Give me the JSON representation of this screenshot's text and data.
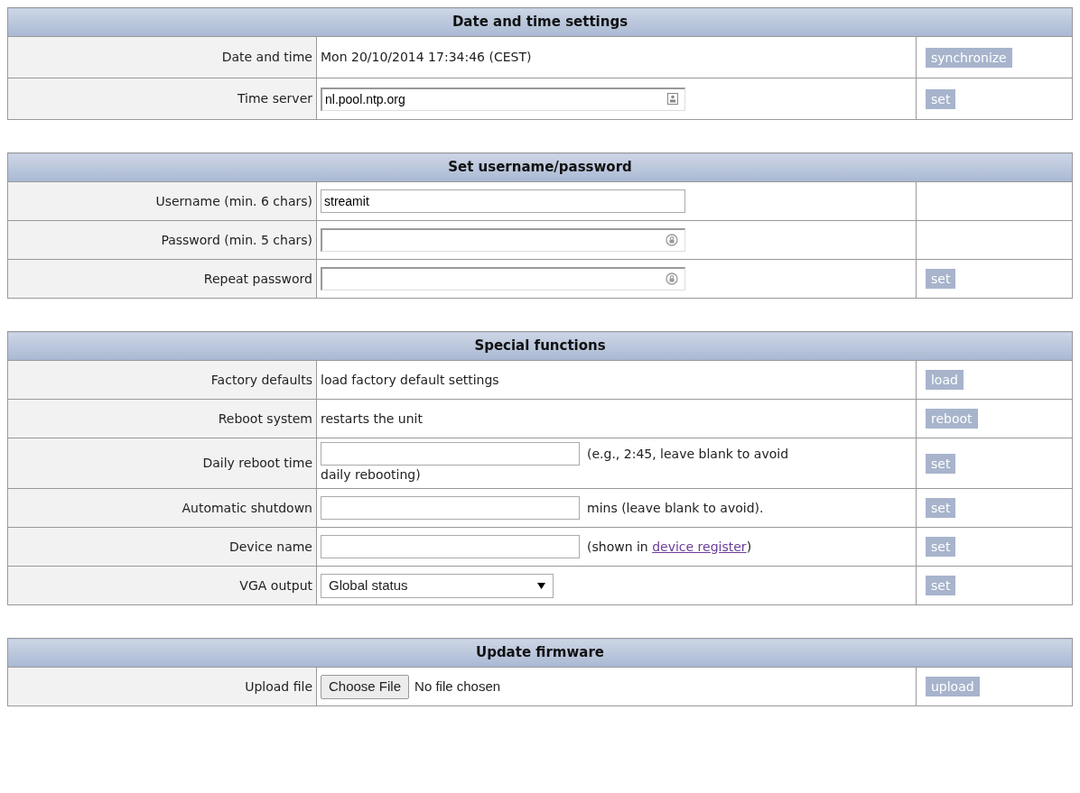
{
  "sections": [
    {
      "title": "Date and time settings",
      "rows": [
        {
          "kind": "text",
          "label": "Date and time",
          "value": "Mon 20/10/2014 17:34:46 (CEST)",
          "button": "synchronize"
        },
        {
          "kind": "autofill_input",
          "label": "Time server",
          "value": "nl.pool.ntp.org",
          "button": "set"
        }
      ]
    },
    {
      "title": "Set username/password",
      "rows": [
        {
          "kind": "input",
          "label": "Username (min. 6 chars)",
          "value": "streamit"
        },
        {
          "kind": "password",
          "label": "Password (min. 5 chars)"
        },
        {
          "kind": "password",
          "label": "Repeat password",
          "button": "set"
        }
      ]
    },
    {
      "title": "Special functions",
      "rows": [
        {
          "kind": "text",
          "label": "Factory defaults",
          "value": "load factory default settings",
          "button": "load"
        },
        {
          "kind": "text",
          "label": "Reboot system",
          "value": "restarts the unit",
          "button": "reboot"
        },
        {
          "kind": "input",
          "label": "Daily reboot time",
          "note": "(e.g., 2:45, leave blank to avoid",
          "note_line_2": "daily rebooting)",
          "button": "set"
        },
        {
          "kind": "input",
          "label": "Automatic shutdown",
          "note": "mins (leave blank to avoid).",
          "button": "set"
        },
        {
          "kind": "input",
          "label": "Device name",
          "note": "(shown in ",
          "link": "device register",
          "note_after": ")",
          "button": "set"
        },
        {
          "kind": "select",
          "label": "VGA output",
          "value": "Global status",
          "button": "set"
        }
      ]
    },
    {
      "title": "Update firmware",
      "rows": [
        {
          "kind": "file",
          "label": "Upload file",
          "file_button": "Choose File",
          "value": "No file chosen",
          "button": "upload"
        }
      ]
    }
  ]
}
